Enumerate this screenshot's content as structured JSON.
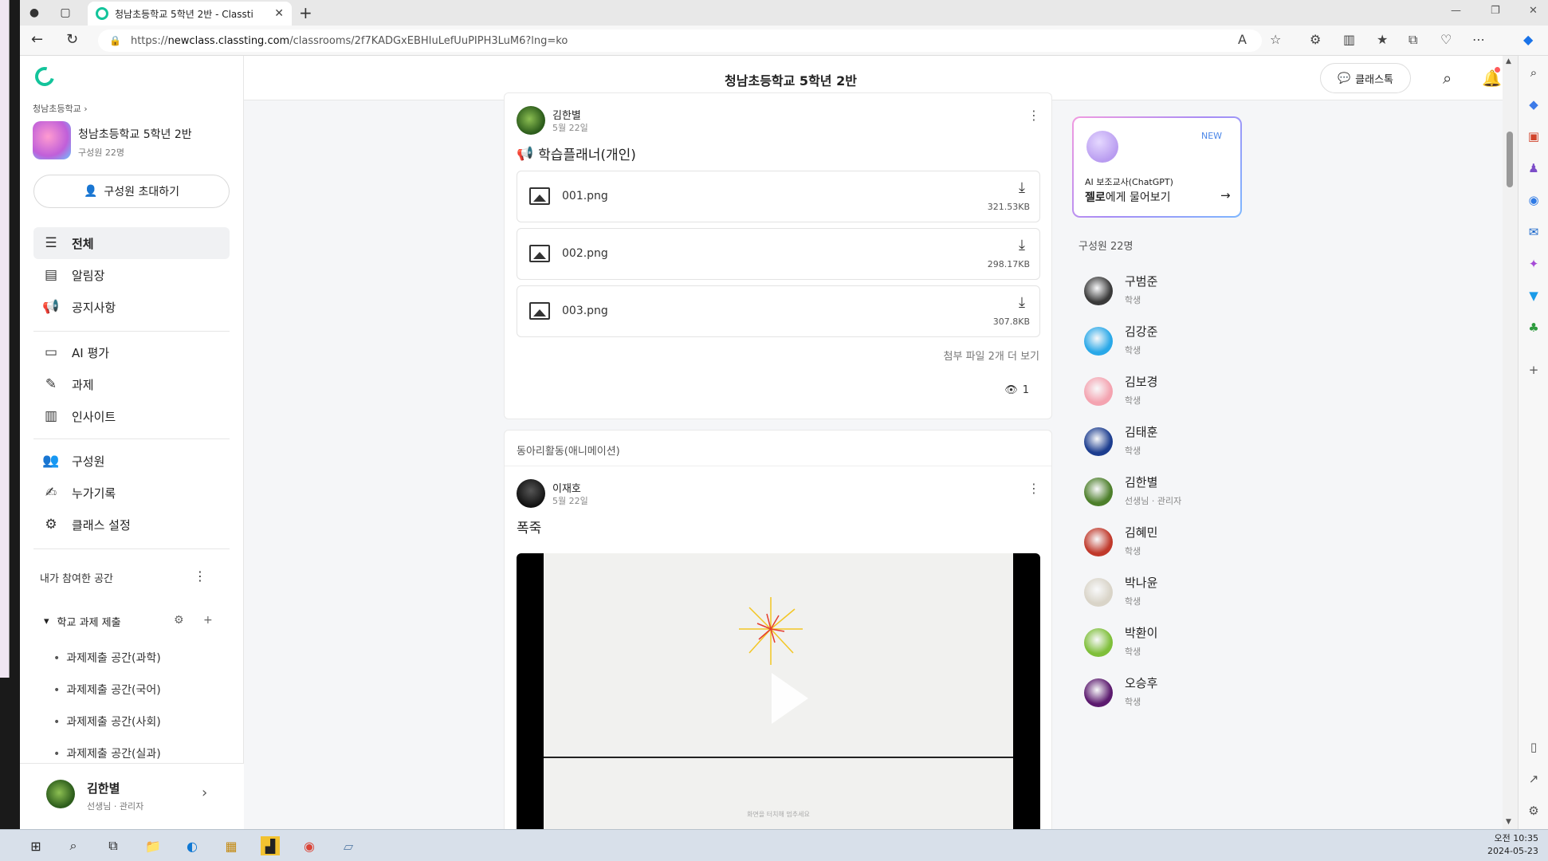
{
  "browser": {
    "tab_title": "청남초등학교 5학년 2반 - Classti",
    "url_prefix": "https://",
    "url_host": "newclass.classting.com",
    "url_path": "/classrooms/2f7KADGxEBHIuLefUuPIPH3LuM6?lng=ko"
  },
  "sidebar": {
    "school": "청남초등학교",
    "class_name": "청남초등학교 5학년 2반",
    "member_count": "구성원 22명",
    "invite_label": "구성원 초대하기",
    "nav": [
      {
        "label": "전체",
        "icon": "list-icon"
      },
      {
        "label": "알림장",
        "icon": "notebook-icon"
      },
      {
        "label": "공지사항",
        "icon": "megaphone-icon"
      },
      {
        "label": "AI 평가",
        "icon": "ai-eval-icon"
      },
      {
        "label": "과제",
        "icon": "pencil-icon"
      },
      {
        "label": "인사이트",
        "icon": "chart-icon"
      },
      {
        "label": "구성원",
        "icon": "members-icon"
      },
      {
        "label": "누가기록",
        "icon": "record-icon"
      },
      {
        "label": "클래스 설정",
        "icon": "gear-icon"
      }
    ],
    "my_spaces_label": "내가 참여한 공간",
    "folder_label": "학교 과제 제출",
    "spaces": [
      "과제제출 공간(과학)",
      "과제제출 공간(국어)",
      "과제제출 공간(사회)",
      "과제제출 공간(실과)"
    ],
    "me": {
      "name": "김한별",
      "role": "선생님 · 관리자"
    }
  },
  "header": {
    "title": "청남초등학교 5학년 2반",
    "classtalk_label": "클래스톡"
  },
  "post1": {
    "author": "김한별",
    "date": "5월 22일",
    "title": "학습플래너(개인)",
    "files": [
      {
        "name": "001.png",
        "size": "321.53KB"
      },
      {
        "name": "002.png",
        "size": "298.17KB"
      },
      {
        "name": "003.png",
        "size": "307.8KB"
      }
    ],
    "more_files": "첨부 파일 2개 더 보기",
    "views": "1"
  },
  "post2": {
    "space": "동아리활동(애니메이션)",
    "author": "이재호",
    "date": "5월 22일",
    "title": "폭죽",
    "video_caption": "화면을 터치해 멈추세요"
  },
  "ai_card": {
    "badge": "NEW",
    "subtitle": "AI 보조교사(ChatGPT)",
    "main_bold": "젤로",
    "main_rest": "에게 물어보기"
  },
  "members": {
    "title": "구성원 22명",
    "list": [
      {
        "name": "구범준",
        "role": "학생",
        "color": "#3a3a3a"
      },
      {
        "name": "김강준",
        "role": "학생",
        "color": "#29a8e8"
      },
      {
        "name": "김보경",
        "role": "학생",
        "color": "#f4a3b0"
      },
      {
        "name": "김태훈",
        "role": "학생",
        "color": "#1c3d8f"
      },
      {
        "name": "김한별",
        "role": "선생님 · 관리자",
        "color": "#4d7f2b"
      },
      {
        "name": "김혜민",
        "role": "학생",
        "color": "#c0392b"
      },
      {
        "name": "박나윤",
        "role": "학생",
        "color": "#d9d4c8"
      },
      {
        "name": "박환이",
        "role": "학생",
        "color": "#7fbf3a"
      },
      {
        "name": "오승후",
        "role": "학생",
        "color": "#5b1a6e"
      }
    ]
  },
  "taskbar": {
    "time_period": "오전 10:35",
    "date": "2024-05-23"
  }
}
